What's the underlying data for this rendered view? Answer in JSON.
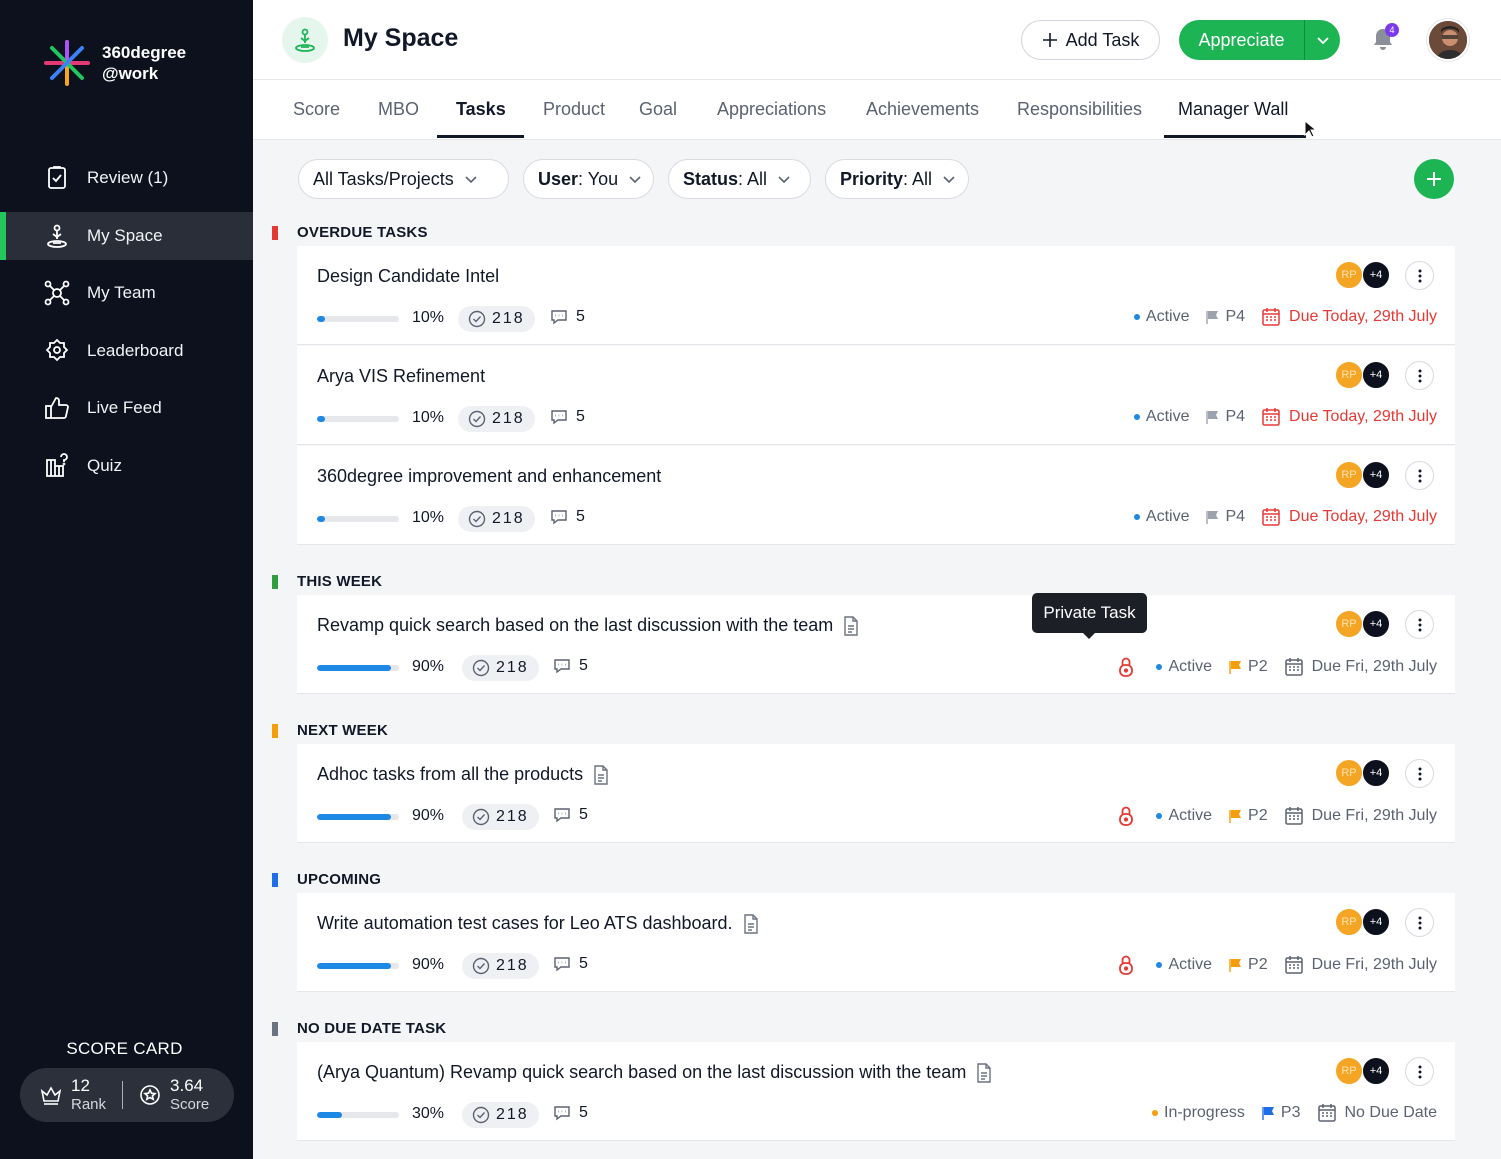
{
  "brand": {
    "line1": "360degree",
    "line2": "@work"
  },
  "sidebar": {
    "items": [
      {
        "label": "Review (1)",
        "icon": "review-icon"
      },
      {
        "label": "My Space",
        "icon": "myspace-icon",
        "active": true
      },
      {
        "label": "My Team",
        "icon": "team-icon"
      },
      {
        "label": "Leaderboard",
        "icon": "leaderboard-icon"
      },
      {
        "label": "Live Feed",
        "icon": "thumbs-up-icon"
      },
      {
        "label": "Quiz",
        "icon": "quiz-icon"
      }
    ],
    "scorecard": {
      "title": "SCORE CARD",
      "rank_value": "12",
      "rank_label": "Rank",
      "score_value": "3.64",
      "score_label": "Score"
    }
  },
  "header": {
    "title": "My Space",
    "add_task": "Add Task",
    "appreciate": "Appreciate",
    "notification_count": "4"
  },
  "tabs": [
    "Score",
    "MBO",
    "Tasks",
    "Product",
    "Goal",
    "Appreciations",
    "Achievements",
    "Responsibilities",
    "Manager Wall"
  ],
  "active_tab": "Tasks",
  "filters": [
    {
      "label": "All Tasks/Projects",
      "value": ""
    },
    {
      "label": "User",
      "value": "You"
    },
    {
      "label": "Status",
      "value": "All"
    },
    {
      "label": "Priority",
      "value": "All"
    }
  ],
  "tooltip": "Private Task",
  "colors": {
    "green": "#1db454",
    "overdue": "#e53935",
    "this_week": "#2e9e3e",
    "next_week": "#f59e0b",
    "upcoming": "#1e6fe5",
    "no_due": "#6b7280",
    "due_red": "#e53935"
  },
  "sections": [
    {
      "title": "OVERDUE TASKS",
      "tasks": [
        {
          "title": "Design Candidate Intel",
          "progress": "10%",
          "checks": "218",
          "comments": "5",
          "status": "Active",
          "priority": "P4",
          "due": "Due Today, 29th July",
          "avatar_initials": "RP",
          "avatar_more": "+4"
        },
        {
          "title": "Arya VIS Refinement",
          "progress": "10%",
          "checks": "218",
          "comments": "5",
          "status": "Active",
          "priority": "P4",
          "due": "Due Today, 29th July",
          "avatar_initials": "RP",
          "avatar_more": "+4"
        },
        {
          "title": "360degree improvement and enhancement",
          "progress": "10%",
          "checks": "218",
          "comments": "5",
          "status": "Active",
          "priority": "P4",
          "due": "Due Today, 29th July",
          "avatar_initials": "RP",
          "avatar_more": "+4"
        }
      ]
    },
    {
      "title": "THIS WEEK",
      "tasks": [
        {
          "title": "Revamp quick search based on the last discussion with the team",
          "progress": "90%",
          "checks": "218",
          "comments": "5",
          "status": "Active",
          "priority": "P2",
          "due": "Due Fri, 29th July",
          "avatar_initials": "RP",
          "avatar_more": "+4"
        }
      ]
    },
    {
      "title": "NEXT WEEK",
      "tasks": [
        {
          "title": "Adhoc tasks from all the products",
          "progress": "90%",
          "checks": "218",
          "comments": "5",
          "status": "Active",
          "priority": "P2",
          "due": "Due Fri, 29th July",
          "avatar_initials": "RP",
          "avatar_more": "+4"
        }
      ]
    },
    {
      "title": "UPCOMING",
      "tasks": [
        {
          "title": "Write automation test cases for Leo ATS dashboard.",
          "progress": "90%",
          "checks": "218",
          "comments": "5",
          "status": "Active",
          "priority": "P2",
          "due": "Due Fri, 29th July",
          "avatar_initials": "RP",
          "avatar_more": "+4"
        }
      ]
    },
    {
      "title": "NO DUE DATE TASK",
      "tasks": [
        {
          "title": "(Arya Quantum) Revamp quick search based on the last discussion with the team",
          "progress": "30%",
          "checks": "218",
          "comments": "5",
          "status": "In-progress",
          "priority": "P3",
          "due": "No Due Date",
          "avatar_initials": "RP",
          "avatar_more": "+4"
        }
      ]
    }
  ]
}
